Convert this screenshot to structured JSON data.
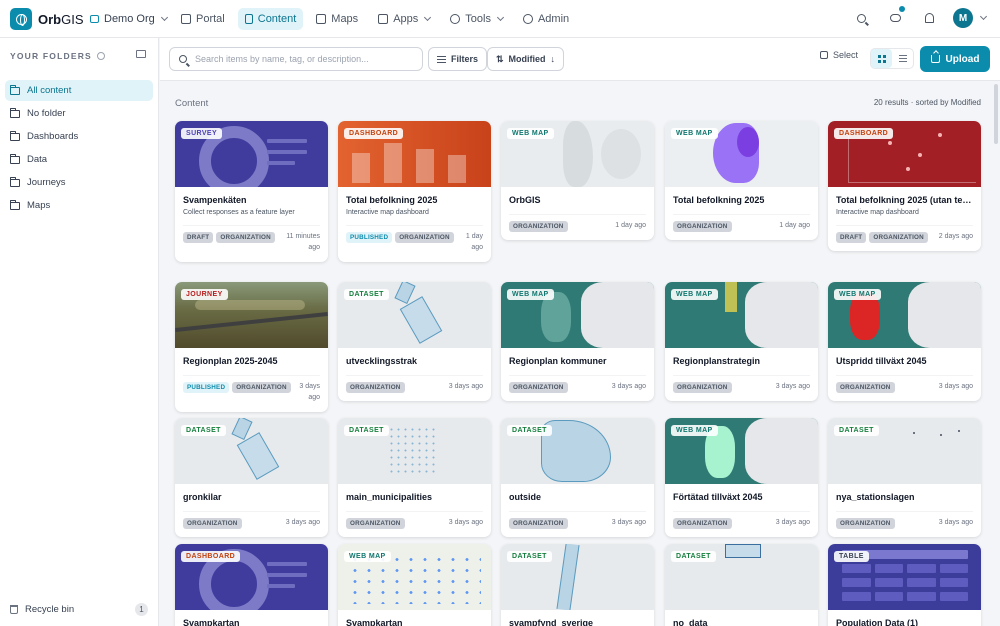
{
  "app": {
    "name_bold": "Orb",
    "name_light": "GIS",
    "org": "Demo Org"
  },
  "nav": [
    "Portal",
    "Content",
    "Maps",
    "Apps",
    "Tools",
    "Admin"
  ],
  "user": {
    "initial": "M"
  },
  "sidebar": {
    "heading": "YOUR FOLDERS",
    "items": [
      "All content",
      "No folder",
      "Dashboards",
      "Data",
      "Journeys",
      "Maps"
    ],
    "recycle_label": "Recycle bin",
    "recycle_count": "1"
  },
  "toolbar": {
    "search_placeholder": "Search items by name, tag, or description...",
    "filters_label": "Filters",
    "sort_label": "Modified",
    "select_label": "Select",
    "upload_label": "Upload"
  },
  "content": {
    "title": "Content",
    "results": "20 results · sorted by Modified"
  },
  "cards": [
    {
      "tag": "SURVEY",
      "title": "Svampenkäten",
      "desc": "Collect responses as a feature layer",
      "badges": [
        "DRAFT",
        "ORGANIZATION"
      ],
      "age": "11 minutes ago"
    },
    {
      "tag": "DASHBOARD",
      "title": "Total befolkning 2025",
      "desc": "Interactive map dashboard",
      "badges": [
        "PUBLISHED",
        "ORGANIZATION"
      ],
      "age": "1 day ago"
    },
    {
      "tag": "WEB MAP",
      "title": "OrbGIS",
      "desc": "",
      "badges": [
        "ORGANIZATION"
      ],
      "age": "1 day ago"
    },
    {
      "tag": "WEB MAP",
      "title": "Total befolkning 2025",
      "desc": "",
      "badges": [
        "ORGANIZATION"
      ],
      "age": "1 day ago"
    },
    {
      "tag": "DASHBOARD",
      "title": "Total befolkning 2025 (utan te…",
      "desc": "Interactive map dashboard",
      "badges": [
        "DRAFT",
        "ORGANIZATION"
      ],
      "age": "2 days ago"
    },
    {
      "tag": "JOURNEY",
      "title": "Regionplan 2025-2045",
      "desc": "",
      "badges": [
        "PUBLISHED",
        "ORGANIZATION"
      ],
      "age": "3 days ago"
    },
    {
      "tag": "DATASET",
      "title": "utvecklingsstrak",
      "desc": "",
      "badges": [
        "ORGANIZATION"
      ],
      "age": "3 days ago"
    },
    {
      "tag": "WEB MAP",
      "title": "Regionplan kommuner",
      "desc": "",
      "badges": [
        "ORGANIZATION"
      ],
      "age": "3 days ago"
    },
    {
      "tag": "WEB MAP",
      "title": "Regionplanstrategin",
      "desc": "",
      "badges": [
        "ORGANIZATION"
      ],
      "age": "3 days ago"
    },
    {
      "tag": "WEB MAP",
      "title": "Utspridd tillväxt 2045",
      "desc": "",
      "badges": [
        "ORGANIZATION"
      ],
      "age": "3 days ago"
    },
    {
      "tag": "DATASET",
      "title": "gronkilar",
      "desc": "",
      "badges": [
        "ORGANIZATION"
      ],
      "age": "3 days ago"
    },
    {
      "tag": "DATASET",
      "title": "main_municipalities",
      "desc": "",
      "badges": [
        "ORGANIZATION"
      ],
      "age": "3 days ago"
    },
    {
      "tag": "DATASET",
      "title": "outside",
      "desc": "",
      "badges": [
        "ORGANIZATION"
      ],
      "age": "3 days ago"
    },
    {
      "tag": "WEB MAP",
      "title": "Förtätad tillväxt 2045",
      "desc": "",
      "badges": [
        "ORGANIZATION"
      ],
      "age": "3 days ago"
    },
    {
      "tag": "DATASET",
      "title": "nya_stationslagen",
      "desc": "",
      "badges": [
        "ORGANIZATION"
      ],
      "age": "3 days ago"
    },
    {
      "tag": "DASHBOARD",
      "title": "Svampkartan",
      "desc": "",
      "badges": [],
      "age": ""
    },
    {
      "tag": "WEB MAP",
      "title": "Svampkartan",
      "desc": "",
      "badges": [],
      "age": ""
    },
    {
      "tag": "DATASET",
      "title": "svampfynd_sverige",
      "desc": "",
      "badges": [],
      "age": ""
    },
    {
      "tag": "DATASET",
      "title": "no_data",
      "desc": "",
      "badges": [],
      "age": ""
    },
    {
      "tag": "TABLE",
      "title": "Population Data (1)",
      "desc": "",
      "badges": [],
      "age": ""
    }
  ],
  "colors": {
    "accent": "#0c8cad",
    "tag_survey": "#4b3fb5",
    "tag_dashboard": "#c2410c",
    "tag_webmap": "#0f766e",
    "tag_dataset": "#15803d",
    "tag_journey": "#b91c1c",
    "tag_table": "#374151"
  }
}
